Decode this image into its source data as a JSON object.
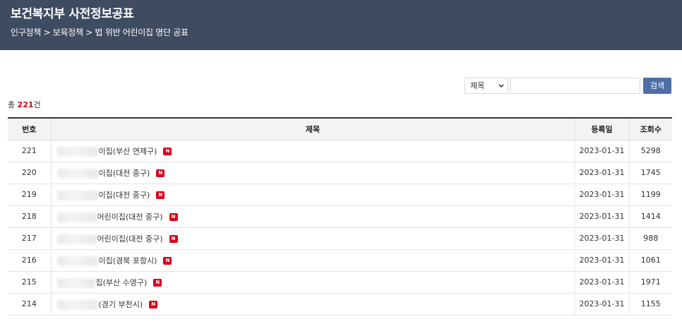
{
  "header": {
    "title": "보건복지부 사전정보공표",
    "breadcrumb": "인구정책 > 보육정책 > 법 위반 어린이집 명단 공표"
  },
  "search": {
    "select_value": "제목",
    "input_placeholder": "",
    "button_label": "검색"
  },
  "total": {
    "prefix": "총",
    "count": "221",
    "suffix": "건"
  },
  "table": {
    "columns": [
      "번호",
      "제목",
      "등록일",
      "조회수"
    ],
    "new_badge": "N",
    "rows": [
      {
        "no": "221",
        "title": "이집(부산 연제구)",
        "date": "2023-01-31",
        "views": "5298"
      },
      {
        "no": "220",
        "title": "이집(대전 중구)",
        "date": "2023-01-31",
        "views": "1745"
      },
      {
        "no": "219",
        "title": "이집(대전 중구)",
        "date": "2023-01-31",
        "views": "1199"
      },
      {
        "no": "218",
        "title": "어린이집(대전 중구)",
        "date": "2023-01-31",
        "views": "1414"
      },
      {
        "no": "217",
        "title": "어린이집(대전 중구)",
        "date": "2023-01-31",
        "views": "988"
      },
      {
        "no": "216",
        "title": "이집(경북 포항시)",
        "date": "2023-01-31",
        "views": "1061"
      },
      {
        "no": "215",
        "title": "집(부산 수영구)",
        "date": "2023-01-31",
        "views": "1971"
      },
      {
        "no": "214",
        "title": "(경기 부천시)",
        "date": "2023-01-31",
        "views": "1155"
      }
    ]
  },
  "colors": {
    "header_bg": "#3f4b61",
    "accent_button": "#4e6fa5",
    "new_badge": "#d9001b"
  }
}
